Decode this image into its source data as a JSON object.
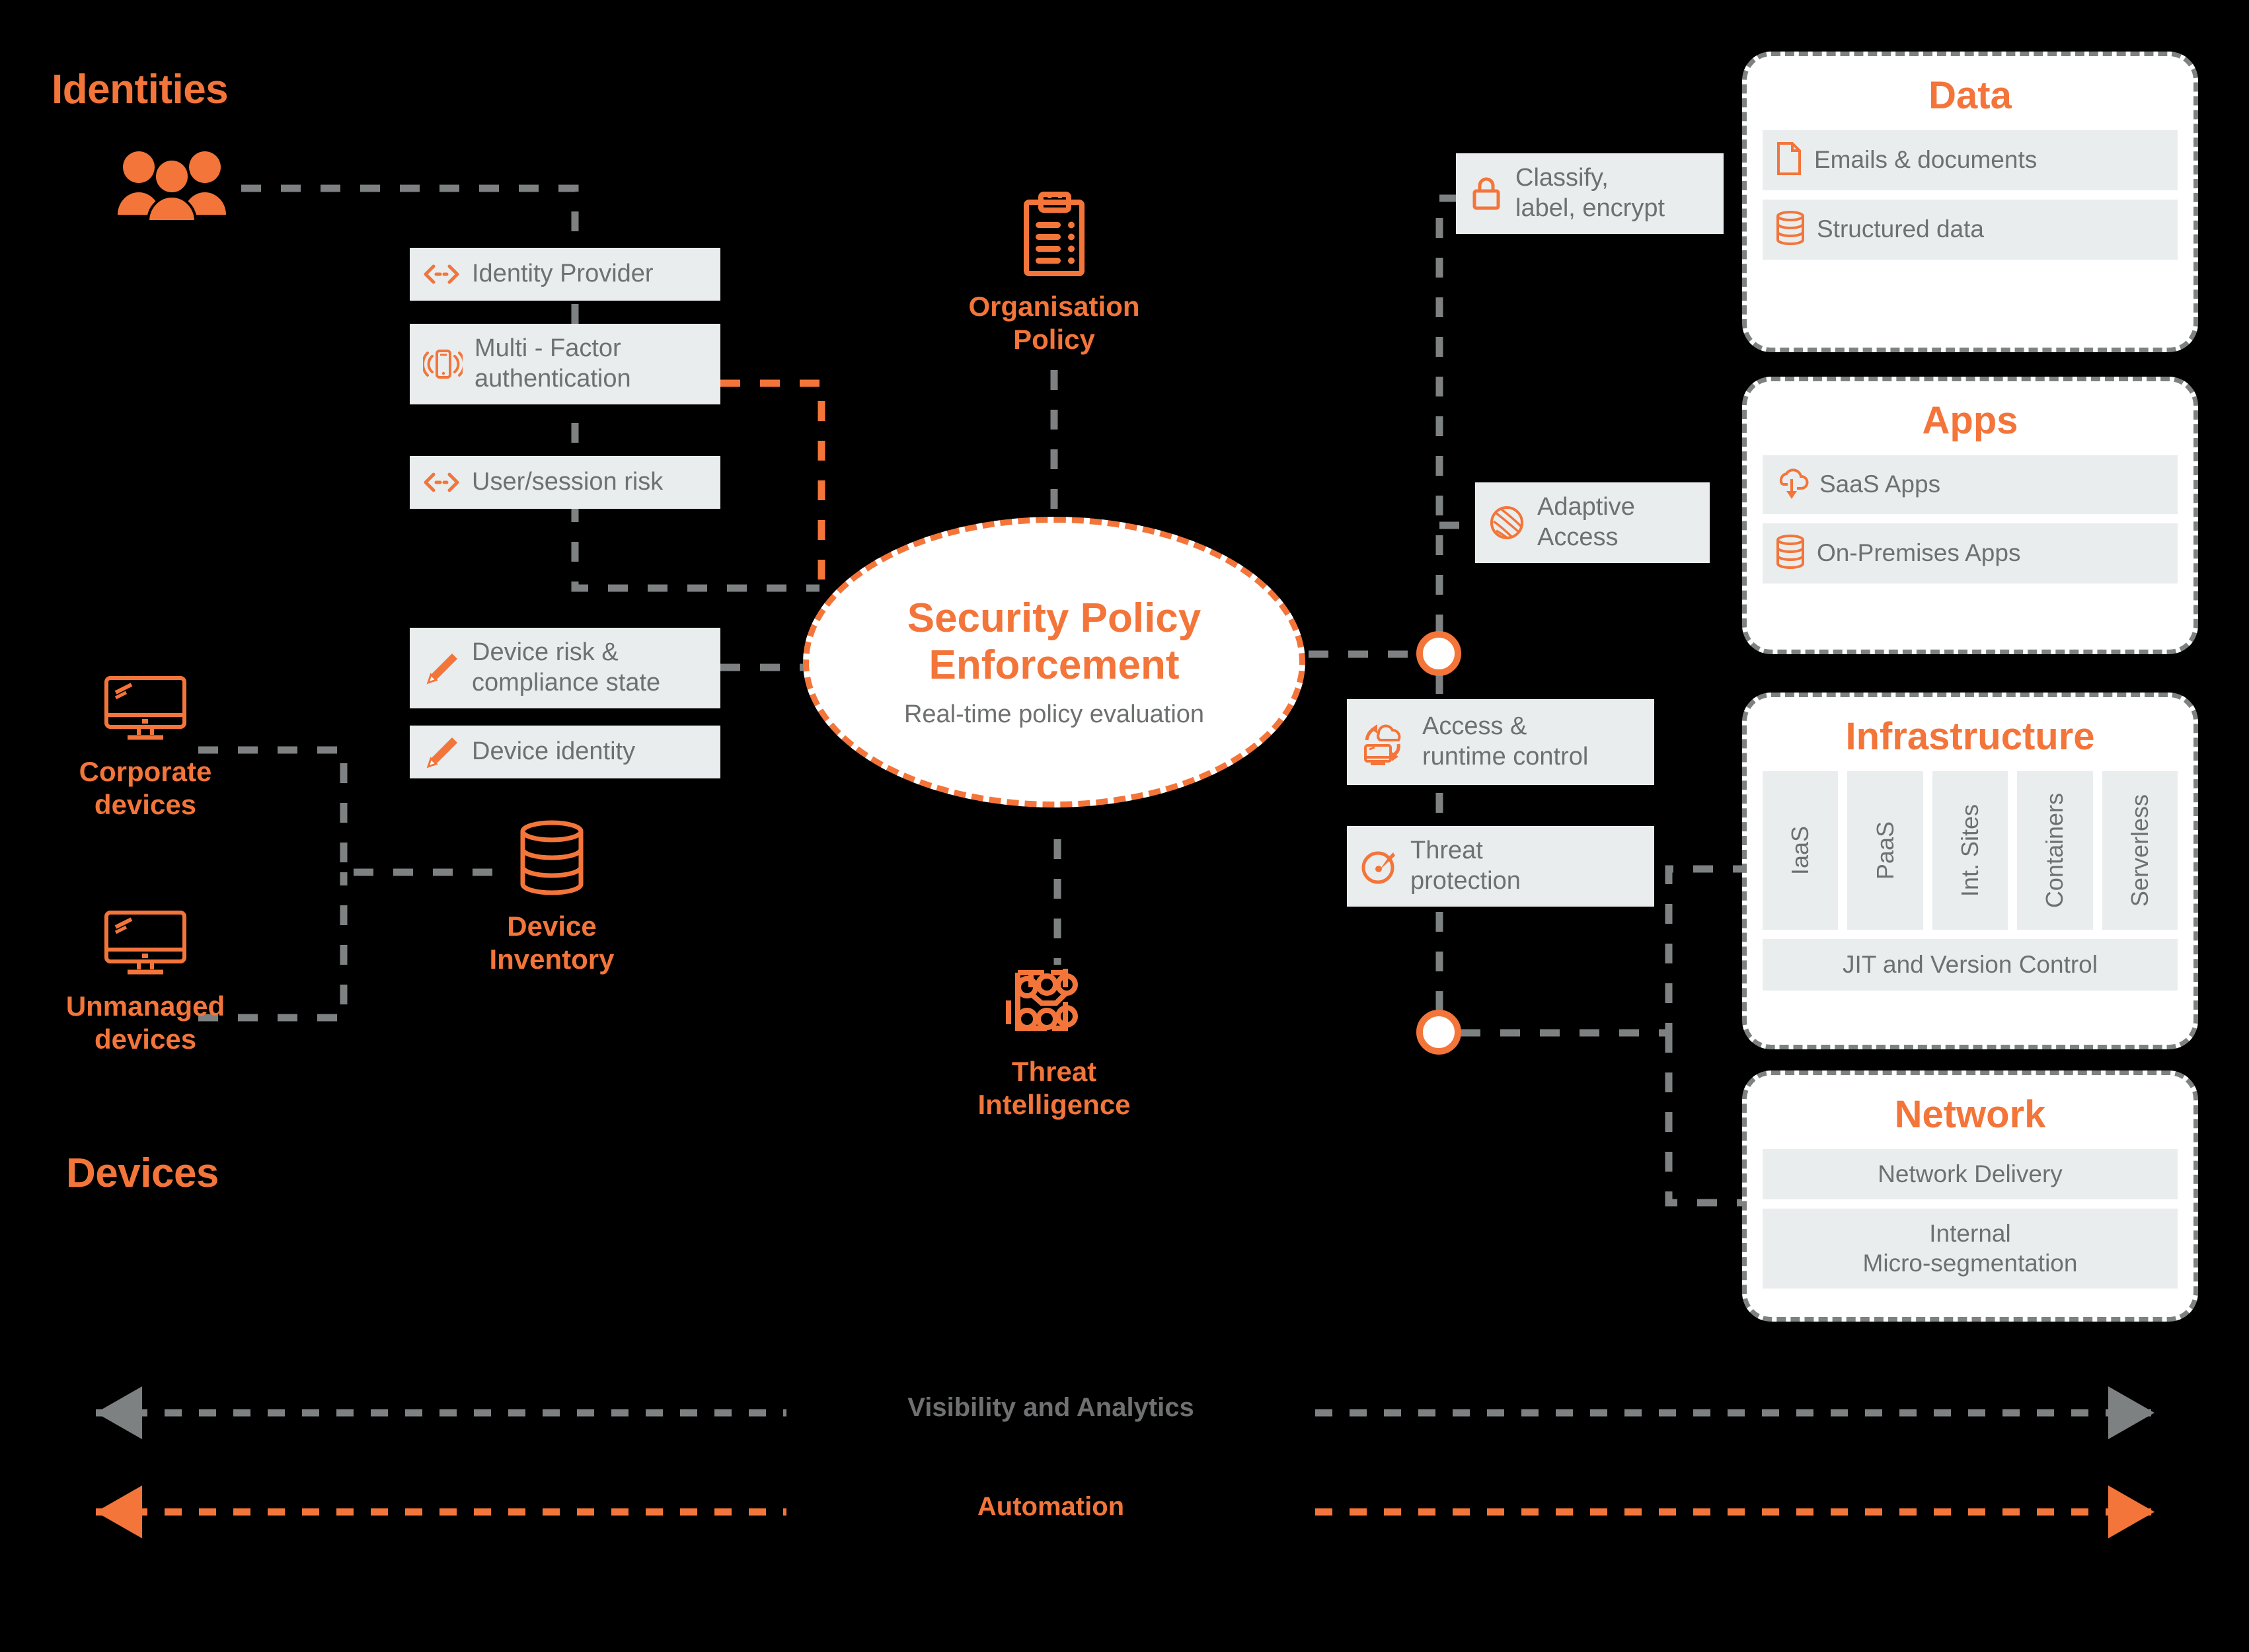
{
  "theme": {
    "background": "#000000",
    "accent": "#F3753A",
    "chip_bg": "#E9EDEE",
    "chip_text": "#6E7071",
    "card_bg": "#FFFFFF",
    "dash_grey": "#7E8182"
  },
  "sections": {
    "identities_title": "Identities",
    "devices_title": "Devices"
  },
  "actors": {
    "users": {
      "icon": "users-group-icon",
      "caption": ""
    },
    "corporate_devices": {
      "icon": "monitor-icon",
      "caption": "Corporate\ndevices"
    },
    "unmanaged_devices": {
      "icon": "monitor-icon",
      "caption": "Unmanaged\ndevices"
    },
    "device_inventory": {
      "icon": "database-icon",
      "caption": "Device\nInventory"
    },
    "organisation_policy": {
      "icon": "clipboard-icon",
      "caption": "Organisation\nPolicy"
    },
    "threat_intelligence": {
      "icon": "circuit-board-icon",
      "caption": "Threat\nIntelligence"
    }
  },
  "signals": [
    {
      "id": "identity-provider",
      "icon": "exchange-arrows-icon",
      "label": "Identity Provider"
    },
    {
      "id": "mfa",
      "icon": "phone-vibrate-icon",
      "label": "Multi - Factor\nauthentication"
    },
    {
      "id": "user-session-risk",
      "icon": "exchange-arrows-icon",
      "label": "User/session risk"
    },
    {
      "id": "device-risk",
      "icon": "pencil-icon",
      "label": "Device risk &\ncompliance state"
    },
    {
      "id": "device-identity",
      "icon": "pencil-icon",
      "label": "Device identity"
    }
  ],
  "core": {
    "title": "Security Policy\nEnforcement",
    "subtitle": "Real-time policy evaluation"
  },
  "controls": [
    {
      "id": "classify",
      "icon": "lock-icon",
      "label": "Classify,\nlabel, encrypt"
    },
    {
      "id": "adaptive-access",
      "icon": "globe-lines-icon",
      "label": "Adaptive\nAccess"
    },
    {
      "id": "access-runtime",
      "icon": "cloud-sync-icon",
      "label": "Access &\nruntime control"
    },
    {
      "id": "threat-protection",
      "icon": "gauge-icon",
      "label": "Threat\nprotection"
    }
  ],
  "pillars": [
    {
      "id": "data",
      "title": "Data",
      "layout": "rows",
      "rows": [
        {
          "icon": "document-icon",
          "label": "Emails & documents"
        },
        {
          "icon": "database-icon",
          "label": "Structured data"
        }
      ]
    },
    {
      "id": "apps",
      "title": "Apps",
      "layout": "rows",
      "rows": [
        {
          "icon": "cloud-download-icon",
          "label": "SaaS Apps"
        },
        {
          "icon": "database-icon",
          "label": "On-Premises Apps"
        }
      ]
    },
    {
      "id": "infrastructure",
      "title": "Infrastructure",
      "layout": "columns",
      "columns": [
        "IaaS",
        "PaaS",
        "Int. Sites",
        "Containers",
        "Serverless"
      ],
      "footer": "JIT and Version Control"
    },
    {
      "id": "network",
      "title": "Network",
      "layout": "rows-centered",
      "rows": [
        {
          "icon": "",
          "label": "Network Delivery"
        },
        {
          "icon": "",
          "label": "Internal\nMicro-segmentation"
        }
      ]
    }
  ],
  "bands": [
    {
      "id": "visibility",
      "label": "Visibility and Analytics",
      "color": "#6E7071"
    },
    {
      "id": "automation",
      "label": "Automation",
      "color": "#F3753A"
    }
  ]
}
